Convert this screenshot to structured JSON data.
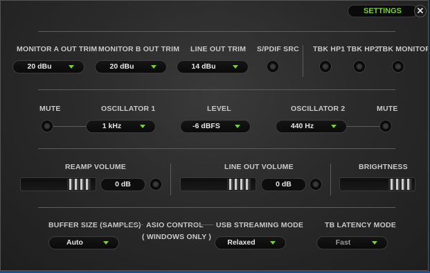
{
  "header": {
    "settings_label": "SETTINGS",
    "close_symbol": "✕"
  },
  "row1": {
    "monitor_a": {
      "label": "MONITOR A OUT TRIM",
      "value": "20 dBu"
    },
    "monitor_b": {
      "label": "MONITOR B OUT TRIM",
      "value": "20 dBu"
    },
    "line_out": {
      "label": "LINE OUT TRIM",
      "value": "14 dBu"
    },
    "spdif": {
      "label": "S/PDIF SRC"
    },
    "tbk_hp1": {
      "label": "TBK HP1"
    },
    "tbk_hp2": {
      "label": "TBK HP2"
    },
    "tbk_monitor": {
      "label": "TBK MONITOR"
    }
  },
  "row2": {
    "mute_left": {
      "label": "MUTE"
    },
    "oscillator1": {
      "label": "OSCILLATOR 1",
      "value": "1 kHz"
    },
    "level": {
      "label": "LEVEL",
      "value": "-6 dBFS"
    },
    "oscillator2": {
      "label": "OSCILLATOR 2",
      "value": "440 Hz"
    },
    "mute_right": {
      "label": "MUTE"
    }
  },
  "row3": {
    "reamp": {
      "label": "REAMP VOLUME",
      "value": "0 dB",
      "level_fraction": 0.72
    },
    "line_out_volume": {
      "label": "LINE OUT VOLUME",
      "value": "0 dB",
      "level_fraction": 0.72
    },
    "brightness": {
      "label": "BRIGHTNESS",
      "level_fraction": 0.75
    }
  },
  "row4": {
    "buffer": {
      "label": "BUFFER SIZE (SAMPLES)",
      "value": "Auto"
    },
    "asio": {
      "label": "ASIO CONTROL",
      "sublabel": "( WINDOWS ONLY )"
    },
    "usb": {
      "label": "USB STREAMING MODE",
      "value": "Relaxed"
    },
    "latency": {
      "label": "TB LATENCY MODE",
      "value": "Fast"
    }
  },
  "colors": {
    "accent": "#7ad13a",
    "panel": "#2b2b2b",
    "text": "#c9c9c9"
  }
}
